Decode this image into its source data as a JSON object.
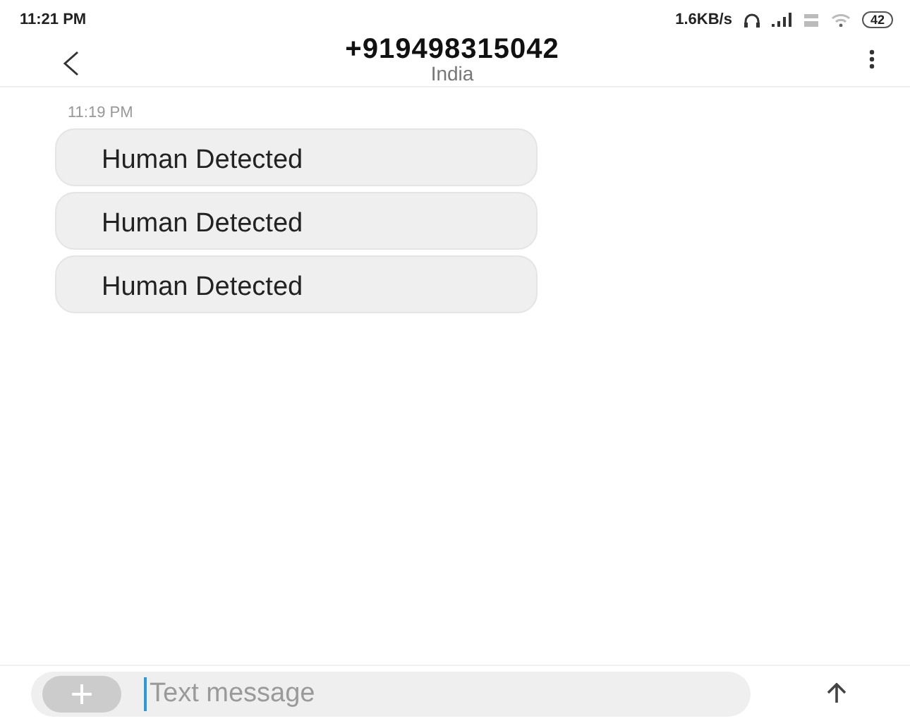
{
  "status_bar": {
    "time": "11:21 PM",
    "speed": "1.6KB/s",
    "battery": "42"
  },
  "header": {
    "title": "+919498315042",
    "subtitle": "India"
  },
  "messages": [
    {
      "timestamp": "11:19 PM",
      "bubbles": [
        "Human Detected",
        "Human Detected",
        "Human Detected"
      ]
    }
  ],
  "composer": {
    "placeholder": "Text message"
  }
}
